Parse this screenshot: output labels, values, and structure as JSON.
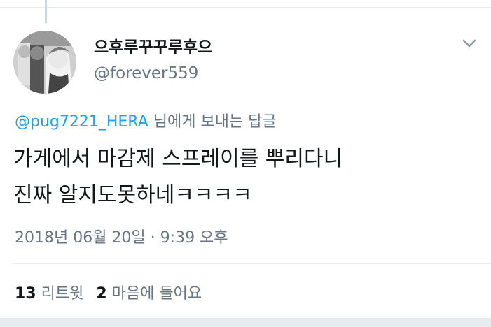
{
  "tweet": {
    "display_name": "으후루꾸꾸루후으",
    "handle": "@forever559",
    "reply_to_mention": "@pug7221_HERA",
    "reply_to_suffix": " 님에게 보내는 답글",
    "text_lines": [
      "가게에서 마감제 스프레이를 뿌리다니",
      "진짜 알지도못하네ㅋㅋㅋㅋ"
    ],
    "timestamp": "2018년 06월 20일 · 9:39 오후"
  },
  "stats": {
    "retweets_count": "13",
    "retweets_label": "리트윗",
    "likes_count": "2",
    "likes_label": "마음에 들어요"
  },
  "icons": {
    "menu": "chevron-down-icon"
  },
  "colors": {
    "text_primary": "#14171a",
    "text_secondary": "#657786",
    "link": "#1da1f2",
    "divider": "#e6ecf0"
  }
}
